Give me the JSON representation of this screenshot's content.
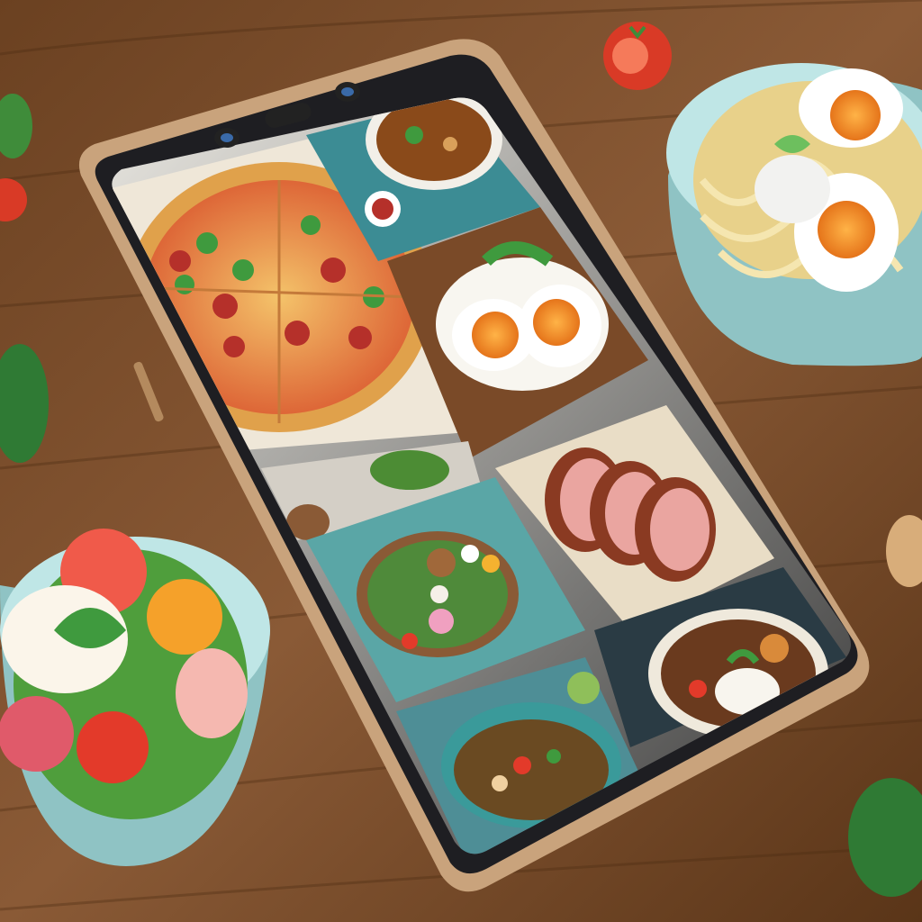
{
  "scene": {
    "kind": "photo-illustration",
    "palette": {
      "wood_light": "#8a5a36",
      "wood_dark": "#5a3518",
      "phone_body": "#2a2a2e",
      "phone_frame_gold": "#c9a37c",
      "teal": "#4f9aa0",
      "bowl_rim": "#bfe6e6",
      "egg_yolk": "#f08a1e",
      "pizza_crust": "#e0a14b",
      "tomato": "#e0392a",
      "herb_green": "#3f8c3a"
    }
  },
  "phone": {
    "screen_tiles": [
      {
        "id": "pizza",
        "icon": "pizza-icon"
      },
      {
        "id": "soup",
        "icon": "soup-bowl-icon"
      },
      {
        "id": "eggs",
        "icon": "egg-icon"
      },
      {
        "id": "meat",
        "icon": "sliced-meat-icon"
      },
      {
        "id": "mixed-bowl",
        "icon": "bowl-icon"
      },
      {
        "id": "noodles",
        "icon": "noodle-bowl-icon"
      },
      {
        "id": "stew",
        "icon": "stew-bowl-icon"
      }
    ]
  },
  "table_items": [
    {
      "id": "ramen-bowl",
      "icon": "ramen-icon"
    },
    {
      "id": "salad-bowl",
      "icon": "salad-icon"
    },
    {
      "id": "tomato",
      "icon": "tomato-icon"
    },
    {
      "id": "leaf",
      "icon": "leaf-icon"
    }
  ]
}
